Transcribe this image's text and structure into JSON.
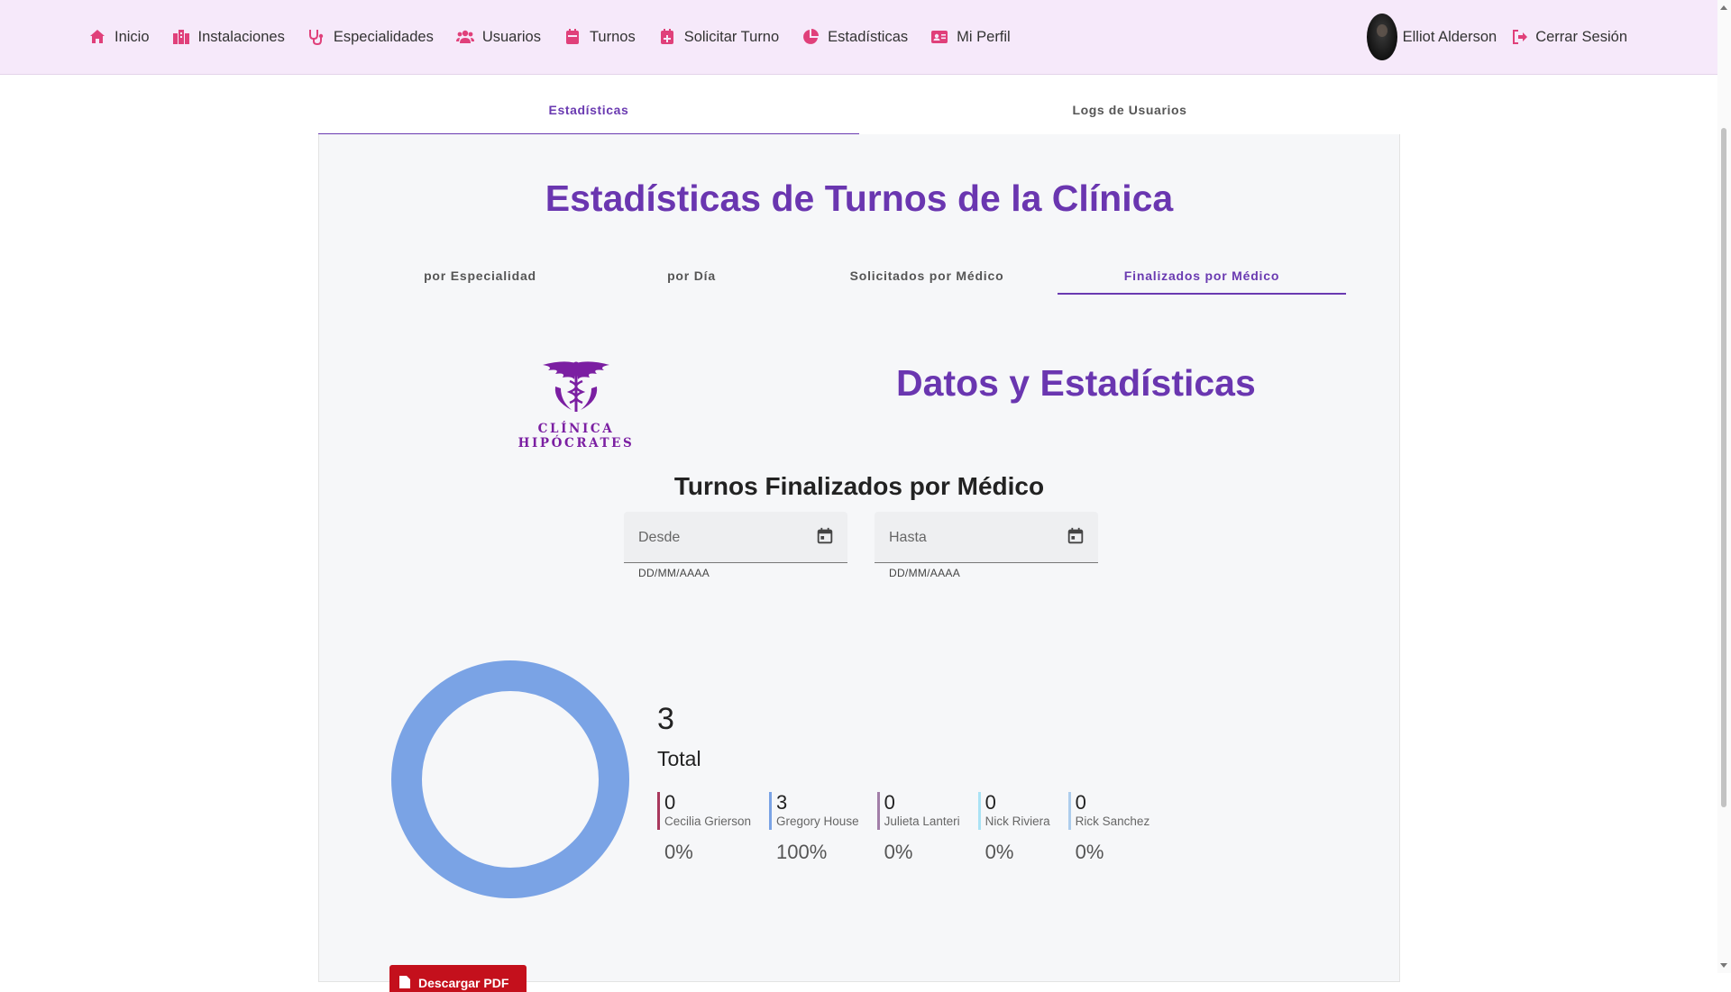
{
  "nav": {
    "items": [
      {
        "label": "Inicio",
        "icon": "home-icon"
      },
      {
        "label": "Instalaciones",
        "icon": "building-icon"
      },
      {
        "label": "Especialidades",
        "icon": "stethoscope-icon"
      },
      {
        "label": "Usuarios",
        "icon": "users-icon"
      },
      {
        "label": "Turnos",
        "icon": "calendar-icon"
      },
      {
        "label": "Solicitar Turno",
        "icon": "calendar-plus-icon"
      },
      {
        "label": "Estadísticas",
        "icon": "pie-chart-icon"
      },
      {
        "label": "Mi Perfil",
        "icon": "id-card-icon"
      }
    ],
    "user_name": "Elliot Alderson",
    "logout_label": "Cerrar Sesión",
    "icon_color": "#e0407a"
  },
  "outer_tabs": [
    "Estadísticas",
    "Logs de Usuarios"
  ],
  "page_title": "Estadísticas de Turnos de la Clínica",
  "inner_tabs": [
    "por Especialidad",
    "por Día",
    "Solicitados por Médico",
    "Finalizados por Médico"
  ],
  "logo_text": "CLÍNICA HIPÓCRATES",
  "data_title": "Datos y Estadísticas",
  "chart_title": "Turnos Finalizados por Médico",
  "date_from": {
    "placeholder": "Desde",
    "hint": "DD/MM/AAAA"
  },
  "date_to": {
    "placeholder": "Hasta",
    "hint": "DD/MM/AAAA"
  },
  "summary": {
    "total_value": "3",
    "total_label": "Total"
  },
  "pdf_button": "Descargar PDF",
  "chart_data": {
    "type": "pie",
    "categories": [
      "Cecilia Grierson",
      "Gregory House",
      "Julieta Lanteri",
      "Nick Riviera",
      "Rick Sanchez"
    ],
    "values": [
      0,
      3,
      0,
      0,
      0
    ],
    "percentages": [
      "0%",
      "100%",
      "0%",
      "0%",
      "0%"
    ],
    "colors": [
      "#a8385d",
      "#7aa3e5",
      "#a27ea8",
      "#aae3f5",
      "#adcded"
    ],
    "total": 3
  }
}
